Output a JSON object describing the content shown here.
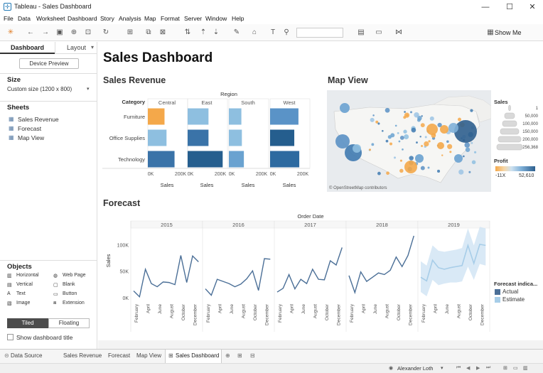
{
  "window": {
    "title": "Tableau - Sales Dashboard",
    "min": "—",
    "max": "☐",
    "close": "✕"
  },
  "menu": [
    "File",
    "Data",
    "Worksheet",
    "Dashboard",
    "Story",
    "Analysis",
    "Map",
    "Format",
    "Server",
    "Window",
    "Help"
  ],
  "toolbar": {
    "show_me": "Show Me"
  },
  "left": {
    "tab_dashboard": "Dashboard",
    "tab_layout": "Layout",
    "device_preview": "Device Preview",
    "size_heading": "Size",
    "size_value": "Custom size (1200 x 800)",
    "sheets_heading": "Sheets",
    "sheets": [
      "Sales Revenue",
      "Forecast",
      "Map View"
    ],
    "objects_heading": "Objects",
    "objects": [
      [
        "Horizontal",
        "Web Page"
      ],
      [
        "Vertical",
        "Blank"
      ],
      [
        "Text",
        "Button"
      ],
      [
        "Image",
        "Extension"
      ]
    ],
    "tiled": "Tiled",
    "floating": "Floating",
    "show_title": "Show dashboard title"
  },
  "dashboard": {
    "title": "Sales Dashboard",
    "sales_revenue_title": "Sales Revenue",
    "map_title": "Map View",
    "forecast_title": "Forecast"
  },
  "chart_data": [
    {
      "type": "bar",
      "title": "Sales Revenue",
      "column_header": "Region",
      "row_header": "Category",
      "categories": [
        "Furniture",
        "Office Supplies",
        "Technology"
      ],
      "panels": [
        "Central",
        "East",
        "South",
        "West"
      ],
      "series": [
        {
          "name": "Central",
          "values": [
            100000,
            112000,
            160000
          ]
        },
        {
          "name": "East",
          "values": [
            125000,
            125000,
            210000
          ]
        },
        {
          "name": "South",
          "values": [
            75000,
            78000,
            90000
          ]
        },
        {
          "name": "West",
          "values": [
            170000,
            145000,
            175000
          ]
        }
      ],
      "colors": [
        [
          "#f4a84a",
          "#8ebfe0",
          "#3a73a8"
        ],
        [
          "#8ebfe0",
          "#3a73a8",
          "#255e8e"
        ],
        [
          "#8ebfe0",
          "#8ebfe0",
          "#6aa2d0"
        ],
        [
          "#5a93c7",
          "#255e8e",
          "#2d6aa0"
        ]
      ],
      "tick_labels": [
        "0K",
        "200K"
      ],
      "xlabel": "Sales",
      "xlim": [
        0,
        230000
      ]
    },
    {
      "type": "scatter",
      "title": "Map View",
      "attribution": "© OpenStreetMap contributors",
      "legend_sales_title": "Sales",
      "legend_sales": [
        "1",
        "50,000",
        "100,000",
        "150,000",
        "200,000",
        "256,368"
      ],
      "legend_profit_title": "Profit",
      "legend_profit_min": "-11X",
      "legend_profit_max": "52,610"
    },
    {
      "type": "line",
      "title": "Forecast",
      "column_header": "Order Date",
      "years": [
        "2015",
        "2016",
        "2017",
        "2018",
        "2019"
      ],
      "months": [
        "February",
        "April",
        "June",
        "August",
        "October",
        "December"
      ],
      "ylabel": "Sales",
      "yticks": [
        "0K",
        "50K",
        "100K"
      ],
      "ylim": [
        0,
        130000
      ],
      "actual": [
        [
          14000,
          3000,
          55000,
          28000,
          22000,
          31000,
          30000,
          26000,
          81000,
          30000,
          80000,
          69000
        ],
        [
          18000,
          6000,
          36000,
          32000,
          28000,
          22000,
          27000,
          37000,
          52000,
          15000,
          75000,
          74000
        ],
        [
          12000,
          19000,
          45000,
          18000,
          36000,
          28000,
          55000,
          36000,
          35000,
          71000,
          63000,
          96000
        ],
        [
          43000,
          11000,
          50000,
          32000,
          40000,
          48000,
          45000,
          53000,
          78000,
          60000,
          81000,
          118000
        ]
      ],
      "estimate": [
        40000,
        33000,
        72000,
        58000,
        55000,
        58000,
        60000,
        62000,
        100000,
        66000,
        102000,
        100000
      ],
      "estimate_low": [
        12000,
        4000,
        35000,
        25000,
        28000,
        30000,
        30000,
        32000,
        60000,
        35000,
        65000,
        62000
      ],
      "estimate_high": [
        70000,
        62000,
        100000,
        90000,
        88000,
        90000,
        92000,
        95000,
        132000,
        100000,
        135000,
        132000
      ],
      "legend_title": "Forecast indica...",
      "legend": [
        "Actual",
        "Estimate"
      ],
      "actual_color": "#4b6f97",
      "estimate_color": "#a7cde8"
    }
  ],
  "tabs": {
    "data_source": "Data Source",
    "sheets": [
      "Sales Revenue",
      "Forecast",
      "Map View"
    ],
    "active": "Sales Dashboard"
  },
  "user": "Alexander Loth"
}
